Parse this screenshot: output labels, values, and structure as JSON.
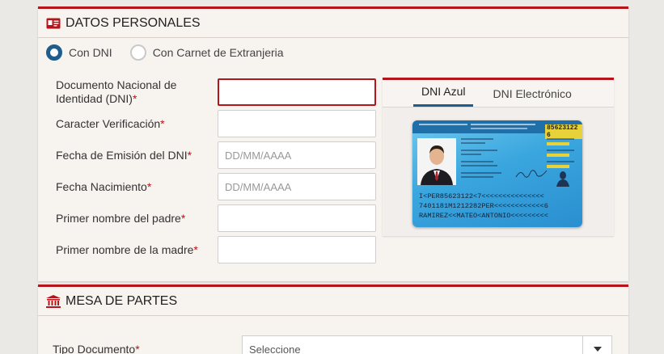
{
  "personal": {
    "title": "DATOS PERSONALES",
    "radio_options": [
      {
        "label": "Con DNI",
        "selected": true
      },
      {
        "label": "Con Carnet de Extranjeria",
        "selected": false
      }
    ],
    "fields": [
      {
        "label": "Documento Nacional de Identidad (DNI)",
        "required": "*",
        "placeholder": "",
        "value": ""
      },
      {
        "label": "Caracter Verificación",
        "required": "*",
        "placeholder": "",
        "value": ""
      },
      {
        "label": "Fecha de Emisión del DNI",
        "required": "*",
        "placeholder": "DD/MM/AAAA",
        "value": ""
      },
      {
        "label": "Fecha Nacimiento",
        "required": "*",
        "placeholder": "DD/MM/AAAA",
        "value": ""
      },
      {
        "label": "Primer nombre del padre",
        "required": "*",
        "placeholder": "",
        "value": ""
      },
      {
        "label": "Primer nombre de la madre",
        "required": "*",
        "placeholder": "",
        "value": ""
      }
    ],
    "dni_tabs": [
      "DNI Azul",
      "DNI Electrónico"
    ],
    "dni_card": {
      "number": "85623122 6",
      "mrz_lines": [
        "I<PER85623122<7<<<<<<<<<<<<<<<",
        "7401181M1212282PER<<<<<<<<<<<<6",
        "RAMIREZ<<MATEO<ANTONIO<<<<<<<<<"
      ]
    }
  },
  "mesa": {
    "title": "MESA DE PARTES",
    "tipo_documento_label": "Tipo Documento",
    "required": "*",
    "select_value": "Seleccione"
  },
  "colors": {
    "accent": "#b4141a",
    "radio": "#1e5d8c"
  },
  "icons": {
    "personal": "id-card-icon",
    "mesa": "institution-icon",
    "select": "caret-down-icon"
  }
}
